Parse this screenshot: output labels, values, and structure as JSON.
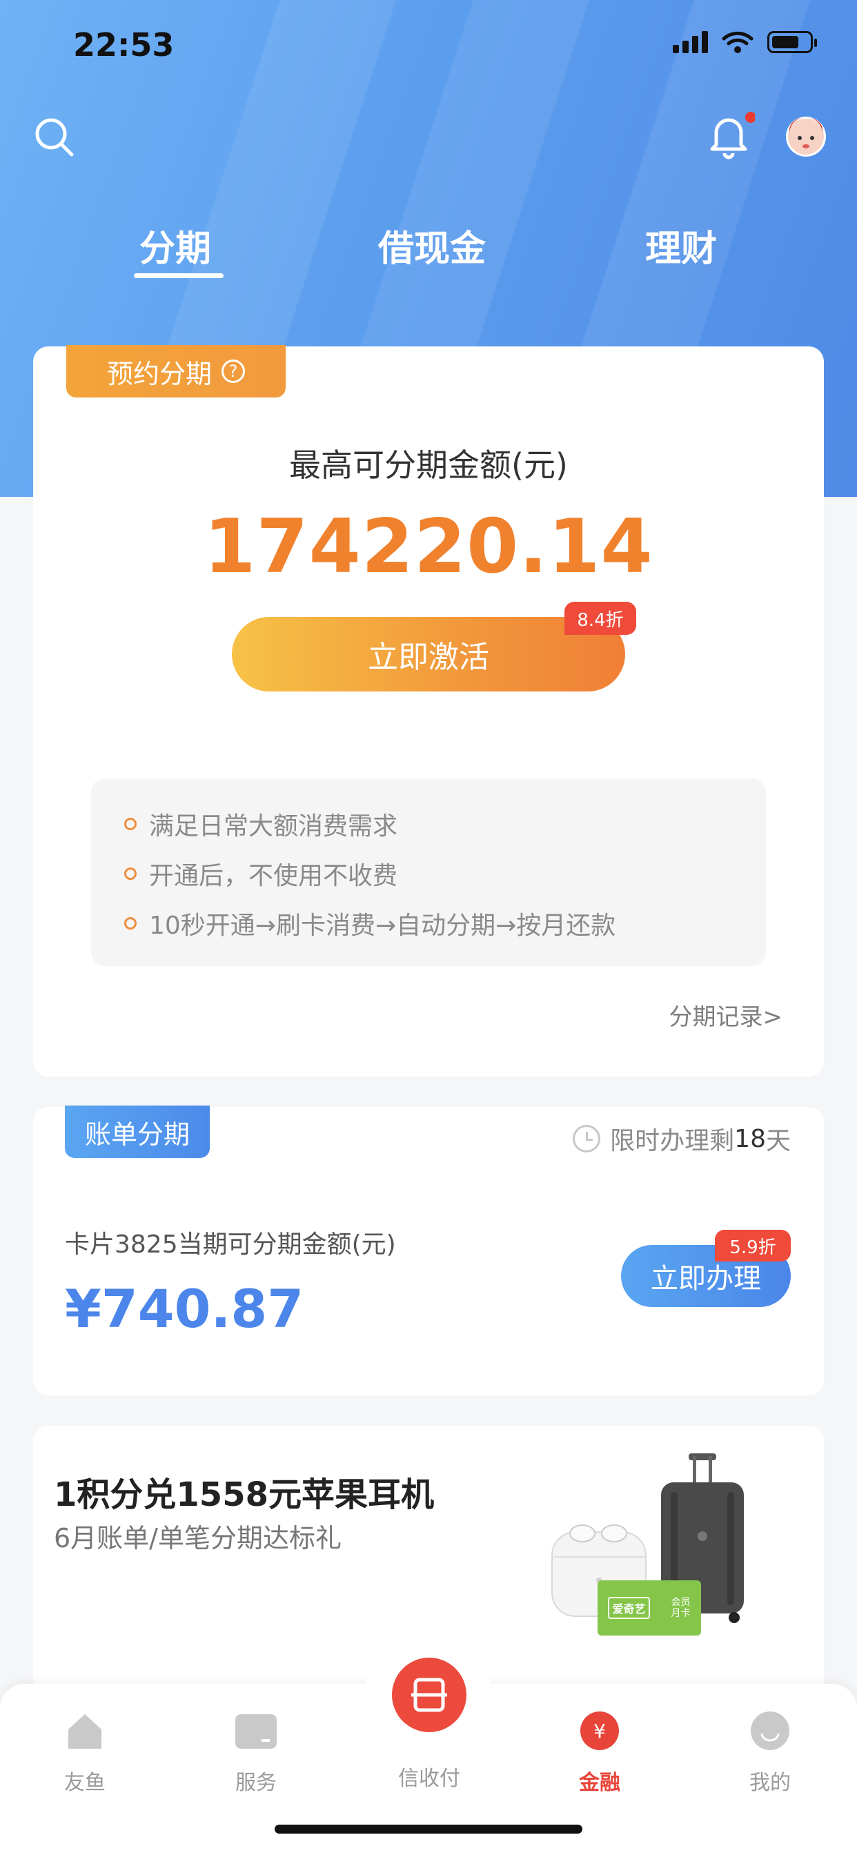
{
  "status_bar": {
    "time": "22:53"
  },
  "top_tabs": [
    {
      "label": "分期",
      "active": true
    },
    {
      "label": "借现金",
      "active": false
    },
    {
      "label": "理财",
      "active": false
    }
  ],
  "installment_card": {
    "tag": "预约分期",
    "amount_label": "最高可分期金额(元)",
    "amount": "174220.14",
    "activate_button": "立即激活",
    "discount_badge": "8.4折",
    "features": [
      "满足日常大额消费需求",
      "开通后，不使用不收费",
      "10秒开通→刷卡消费→自动分期→按月还款"
    ],
    "record_link": "分期记录>"
  },
  "bill_card": {
    "tag": "账单分期",
    "limit_prefix": "限时办理剩",
    "limit_days": "18",
    "limit_suffix": "天",
    "card_line": "卡片3825当期可分期金额(元)",
    "amount": "¥740.87",
    "button": "立即办理",
    "discount_badge": "5.9折"
  },
  "promo": {
    "title": "1积分兑1558元苹果耳机",
    "subtitle": "6月账单/单笔分期达标礼",
    "voucher_brand": "爱奇艺",
    "voucher_text": "会员月卡"
  },
  "bottom_nav": [
    {
      "label": "友鱼",
      "icon": "home-icon",
      "active": false
    },
    {
      "label": "服务",
      "icon": "service-icon",
      "active": false
    },
    {
      "label": "信收付",
      "icon": "scan-pay-icon",
      "active": false
    },
    {
      "label": "金融",
      "icon": "yuan-icon",
      "active": true
    },
    {
      "label": "我的",
      "icon": "profile-icon",
      "active": false
    }
  ],
  "colors": {
    "accent_orange": "#f0822e",
    "accent_blue": "#4c86ea",
    "nav_active": "#e8453a"
  }
}
